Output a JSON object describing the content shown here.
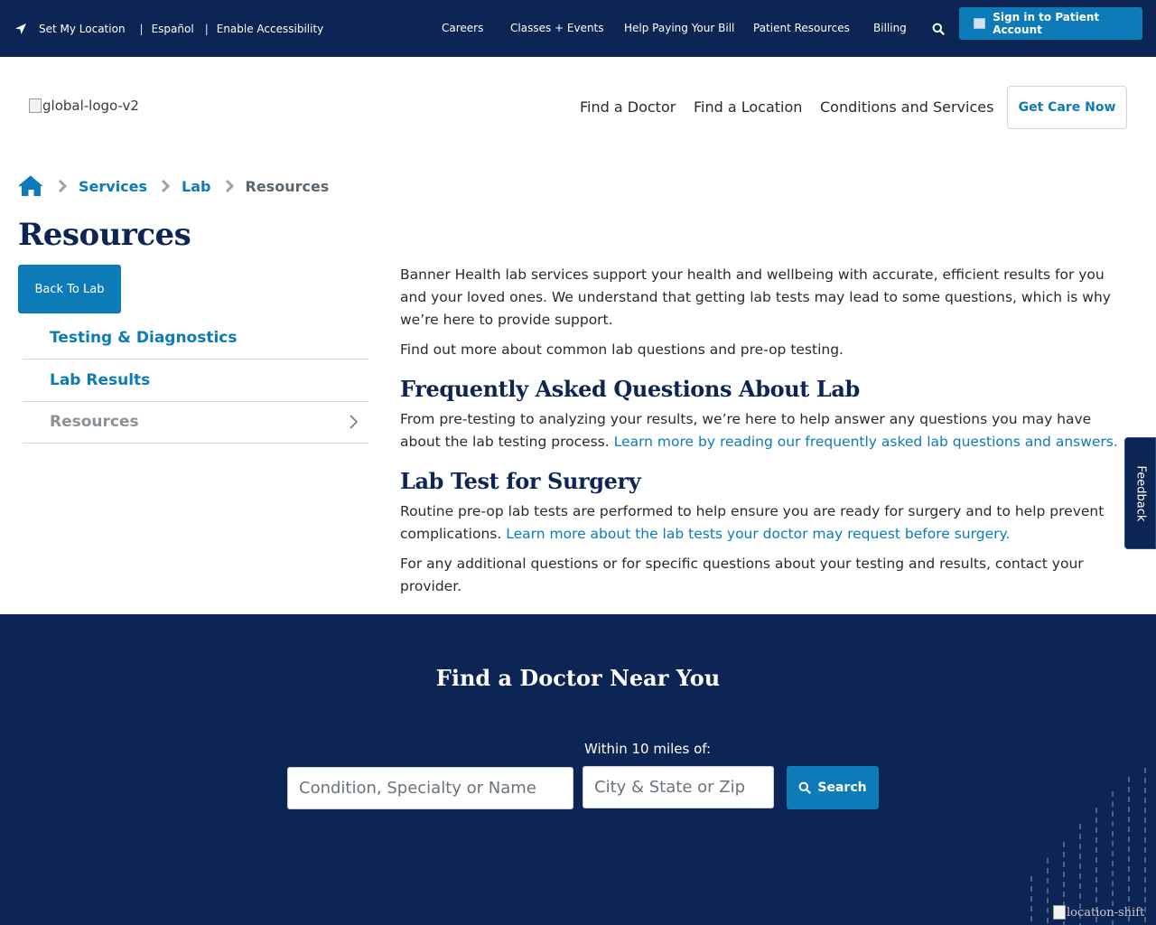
{
  "utility_bar": {
    "set_location": "Set My Location",
    "language": "Español",
    "accessibility": "Enable Accessibility",
    "links": [
      "Careers",
      "Classes + Events",
      "Help Paying Your Bill",
      "Patient Resources",
      "Billing"
    ],
    "signin_label": "Sign in to Patient Account",
    "bg_color": "#0d2554",
    "accent_color": "#0c7bb7"
  },
  "header": {
    "logo_alt": "global-logo-v2",
    "nav": [
      "Find a Doctor",
      "Find a Location",
      "Conditions and Services"
    ],
    "cta_label": "Get Care Now"
  },
  "breadcrumb": {
    "items": [
      "Services",
      "Lab"
    ],
    "current": "Resources"
  },
  "page": {
    "title": "Resources"
  },
  "side_nav": {
    "back_label": "Back To Lab",
    "items": [
      "Testing & Diagnostics",
      "Lab Results",
      "Resources"
    ]
  },
  "content": {
    "intro": "Banner Health lab services support your health and wellbeing with accurate, efficient results for you and your loved ones. We understand that getting lab tests may lead to some questions, which is why we’re here to provide support.",
    "intro2": "Find out more about common lab questions and pre-op testing.",
    "faq_heading": "Frequently Asked Questions About Lab",
    "faq_text": "From pre-testing to analyzing your results, we’re here to help answer any questions you may have about the lab testing process.",
    "faq_link": "Learn more by reading our frequently asked lab questions and answers.",
    "surgery_heading": "Lab Test for Surgery",
    "surgery_text": "Routine pre-op lab tests are performed to help ensure you are ready for surgery and to help prevent complications.",
    "surgery_link": "Learn more about the lab tests your doctor may request before surgery.",
    "closing": "For any additional questions or for specific questions about your testing and results, contact your provider."
  },
  "feedback": {
    "label": "Feedback"
  },
  "find_doctor": {
    "title": "Find a Doctor Near You",
    "within_label": "Within 10 miles of:",
    "condition_placeholder": "Condition, Specialty or Name",
    "city_placeholder": "City & State or Zip",
    "search_label": "Search",
    "deco_alt": "location-shift"
  }
}
